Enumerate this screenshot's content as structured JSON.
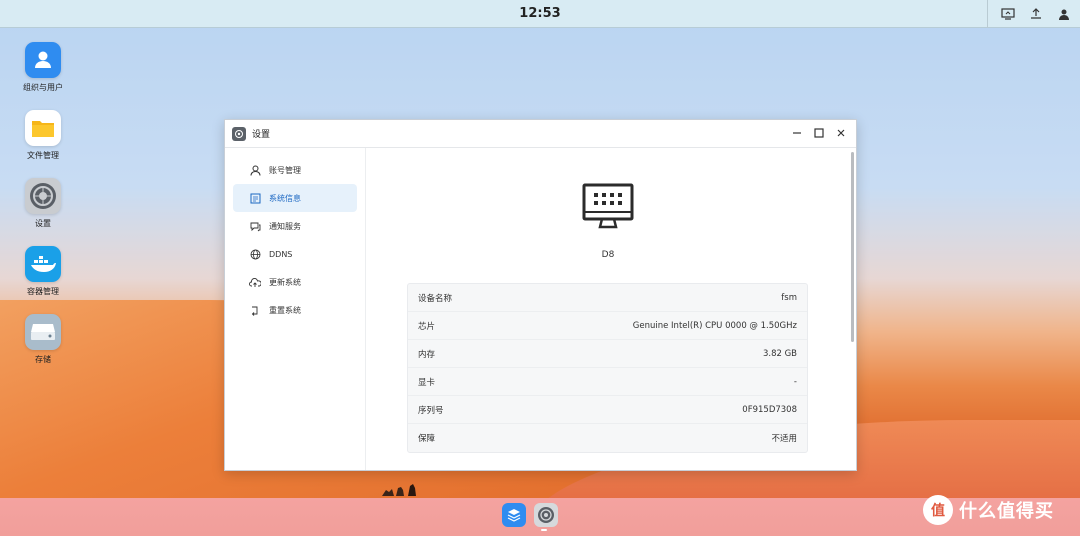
{
  "topbar": {
    "clock": "12:53"
  },
  "desktop": {
    "icons": [
      {
        "label": "组织与用户",
        "icon": "user-icon",
        "color": "#2f8cf0"
      },
      {
        "label": "文件管理",
        "icon": "folder-icon",
        "color": "#f6b619"
      },
      {
        "label": "设置",
        "icon": "gear-icon",
        "color": "#6c7178"
      },
      {
        "label": "容器管理",
        "icon": "docker-icon",
        "color": "#1aa0e8"
      },
      {
        "label": "存储",
        "icon": "storage-icon",
        "color": "#8fa6b8"
      }
    ]
  },
  "window": {
    "title": "设置",
    "sidebar": [
      {
        "label": "账号管理",
        "icon": "user-outline-icon",
        "active": false
      },
      {
        "label": "系统信息",
        "icon": "info-box-icon",
        "active": true
      },
      {
        "label": "通知服务",
        "icon": "chat-icon",
        "active": false
      },
      {
        "label": "DDNS",
        "icon": "globe-icon",
        "active": false
      },
      {
        "label": "更新系统",
        "icon": "cloud-sync-icon",
        "active": false
      },
      {
        "label": "重置系统",
        "icon": "reset-icon",
        "active": false
      }
    ],
    "device_name": "D8",
    "info_rows": [
      {
        "key": "设备名称",
        "value": "fsm"
      },
      {
        "key": "芯片",
        "value": "Genuine Intel(R) CPU 0000 @ 1.50GHz"
      },
      {
        "key": "内存",
        "value": "3.82 GB"
      },
      {
        "key": "显卡",
        "value": "-"
      },
      {
        "key": "序列号",
        "value": "0F915D7308"
      },
      {
        "key": "保障",
        "value": "不适用"
      }
    ]
  },
  "watermark": {
    "badge": "值",
    "text": "什么值得买"
  }
}
